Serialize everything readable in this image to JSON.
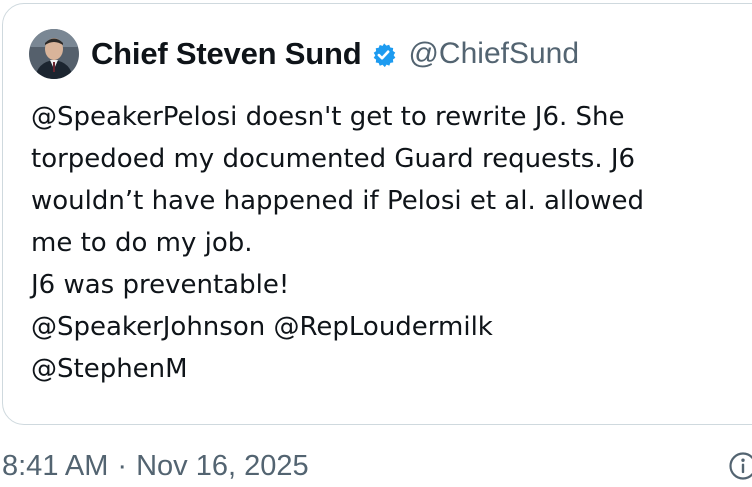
{
  "quote": {
    "author": {
      "name": "Chief Steven Sund",
      "handle": "@ChiefSund",
      "verified_icon": "verified-badge-icon",
      "verified_color": "#1d9bf0"
    },
    "text_lines": [
      "@SpeakerPelosi doesn't get to rewrite J6. She",
      "torpedoed my documented Guard requests. J6",
      "wouldn’t have happened if Pelosi et al. allowed",
      "me to do my job.",
      "J6 was preventable!",
      "@SpeakerJohnson @RepLoudermilk",
      "@StephenM"
    ]
  },
  "meta": {
    "time": "8:41 AM",
    "separator": "·",
    "date": "Nov 16, 2025",
    "info_icon": "info-icon"
  }
}
